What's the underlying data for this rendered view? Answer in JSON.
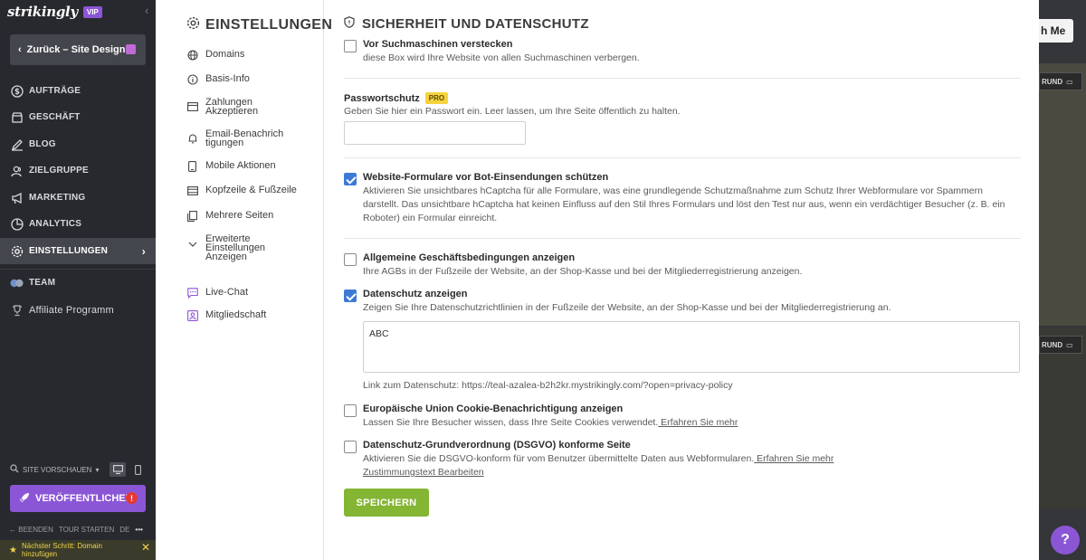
{
  "brand": {
    "logo": "strikingly",
    "badge": "VIP"
  },
  "sidebar": {
    "back_label": "Zurück – Site Design",
    "items": [
      {
        "label": "AUFTRÄGE",
        "icon": "dollar-icon"
      },
      {
        "label": "GESCHÄFT",
        "icon": "store-icon"
      },
      {
        "label": "BLOG",
        "icon": "pen-icon"
      },
      {
        "label": "ZIELGRUPPE",
        "icon": "users-icon"
      },
      {
        "label": "MARKETING",
        "icon": "megaphone-icon"
      },
      {
        "label": "ANALYTICS",
        "icon": "chart-icon"
      },
      {
        "label": "EINSTELLUNGEN",
        "icon": "gear-icon"
      }
    ],
    "team_label": "TEAM",
    "affiliate_label": "Affiliate Programm",
    "preview_label": "SITE VORSCHAUEN",
    "publish_label": "VERÖFFENTLICHEN",
    "footer": {
      "exit": "BEENDEN",
      "tour": "TOUR STARTEN",
      "lang": "DE",
      "more": "•••"
    },
    "next_step": "Nächster Schritt: Domain hinzufügen"
  },
  "backdrop": {
    "button_text": "h Me",
    "chip1": "RUND",
    "chip2": "RUND",
    "help": "?"
  },
  "settings_nav": {
    "title": "EINSTELLUNGEN",
    "items": [
      {
        "label": "Domains",
        "icon": "globe-icon"
      },
      {
        "label": "Basis-Info",
        "icon": "info-icon"
      },
      {
        "label": "Zahlungen Akzeptieren",
        "icon": "card-icon"
      },
      {
        "label": "Email-Benachrichtigungen",
        "icon": "bell-icon"
      },
      {
        "label": "Mobile Aktionen",
        "icon": "mobile-icon"
      },
      {
        "label": "Kopfzeile & Fußzeile",
        "icon": "layout-icon"
      },
      {
        "label": "Mehrere Seiten",
        "icon": "pages-icon"
      },
      {
        "label": "Erweiterte Einstellungen Anzeigen",
        "icon": "chevron-down-icon"
      },
      {
        "label": "Live-Chat",
        "icon": "chat-icon"
      },
      {
        "label": "Mitgliedschaft",
        "icon": "member-icon"
      }
    ]
  },
  "security": {
    "title": "SICHERHEIT UND DATENSCHUTZ",
    "hide_search": {
      "label": "Vor Suchmaschinen verstecken",
      "desc": "diese Box wird Ihre Website von allen Suchmaschinen verbergen.",
      "checked": false
    },
    "password": {
      "label": "Passwortschutz",
      "badge": "PRO",
      "desc": "Geben Sie hier ein Passwort ein. Leer lassen, um Ihre Seite öffentlich zu halten.",
      "value": ""
    },
    "bot_protect": {
      "label": "Website-Formulare vor Bot-Einsendungen schützen",
      "desc": "Aktivieren Sie unsichtbares hCaptcha für alle Formulare, was eine grundlegende Schutzmaßnahme zum Schutz Ihrer Webformulare vor Spammern darstellt. Das unsichtbare hCaptcha hat keinen Einfluss auf den Stil Ihres Formulars und löst den Test nur aus, wenn ein verdächtiger Besucher (z. B. ein Roboter) ein Formular einreicht.",
      "checked": true
    },
    "terms": {
      "label": "Allgemeine Geschäftsbedingungen anzeigen",
      "desc": "Ihre AGBs in der Fußzeile der Website, an der Shop-Kasse und bei der Mitgliederregistrierung anzeigen.",
      "checked": false
    },
    "privacy": {
      "label": "Datenschutz anzeigen",
      "desc": "Zeigen Sie Ihre Datenschutzrichtlinien in der Fußzeile der Website, an der Shop-Kasse und bei der Mitgliederregistrierung an.",
      "checked": true,
      "text": "ABC",
      "link": "Link zum Datenschutz: https://teal-azalea-b2h2kr.mystrikingly.com/?open=privacy-policy"
    },
    "eu_cookie": {
      "label": "Europäische Union Cookie-Benachrichtigung anzeigen",
      "desc": "Lassen Sie Ihre Besucher wissen, dass Ihre Seite Cookies verwendet.",
      "more": " Erfahren Sie mehr",
      "checked": false
    },
    "gdpr": {
      "label": "Datenschutz-Grundverordnung (DSGVO) konforme Seite",
      "desc": "Aktivieren Sie die DSGVO-konform für vom Benutzer übermittelte Daten aus Webformularen.",
      "more": " Erfahren Sie mehr",
      "consent_link": "Zustimmungstext Bearbeiten",
      "checked": false
    },
    "save_label": "SPEICHERN"
  },
  "colors": {
    "accent": "#8b56d6",
    "save": "#84b533",
    "checkbox": "#3d7ad6",
    "pro_badge": "#f6d33c"
  }
}
